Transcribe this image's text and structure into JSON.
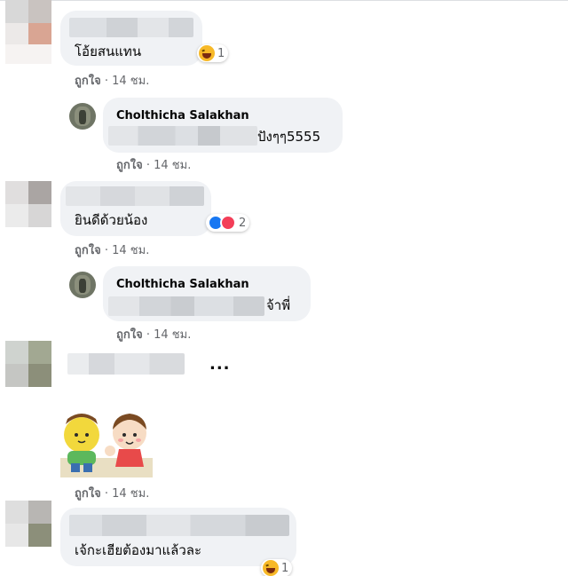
{
  "comments": [
    {
      "text": "โอ้ยสนแทน",
      "reaction_count": "1",
      "like_label": "ถูกใจ",
      "time": "· 14 ชม."
    },
    {
      "author": "Cholthicha Salakhan",
      "text_suffix": "ปังๆๆ5555",
      "like_label": "ถูกใจ",
      "time": "· 14 ชม."
    },
    {
      "text": "ยินดีด้วยน้อง",
      "reaction_count": "2",
      "like_label": "ถูกใจ",
      "time": "· 14 ชม."
    },
    {
      "author": "Cholthicha Salakhan",
      "text_suffix": "จ้าพี่",
      "like_label": "ถูกใจ",
      "time": "· 14 ชม."
    },
    {
      "more_label": "...",
      "like_label": "ถูกใจ",
      "time": "· 14 ชม."
    },
    {
      "text": "เจ้กะเฮียต้องมาแล้วละ",
      "reaction_count": "1"
    }
  ],
  "colors": {
    "bubble": "#f0f2f5",
    "meta_text": "#65676b",
    "like_reaction": "#1877f2",
    "love_reaction": "#f33e58",
    "haha_reaction": "#f7b928"
  },
  "icons": [
    "haha-reaction-icon",
    "like-reaction-icon",
    "love-reaction-icon",
    "more-options-icon",
    "sticker"
  ]
}
